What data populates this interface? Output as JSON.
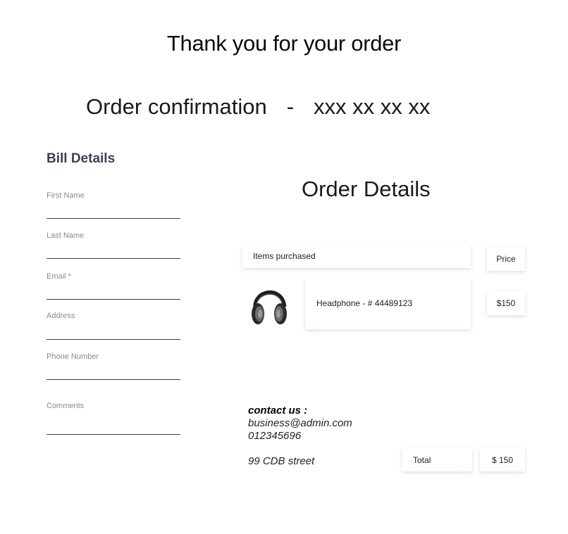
{
  "header": {
    "thanks": "Thank you for your order",
    "confirmation_label": "Order confirmation",
    "separator": "-",
    "confirmation_number": "xxx xx xx xx"
  },
  "bill": {
    "title": "Bill Details",
    "fields": {
      "first_name": "First Name",
      "last_name": "Last Name",
      "email": "Email *",
      "address": "Address",
      "phone": "Phone Number",
      "comments": "Comments"
    }
  },
  "order": {
    "title": "Order Details",
    "items_header": "Items purchased",
    "price_header": "Price",
    "item": {
      "name": "Headphone - # 44489123",
      "price": "$150",
      "icon": "headphone-icon"
    },
    "total_label": "Total",
    "total_value": "$ 150"
  },
  "contact": {
    "heading": "contact us :",
    "email": "business@admin.com",
    "phone": "012345696",
    "street": "99 CDB street"
  }
}
